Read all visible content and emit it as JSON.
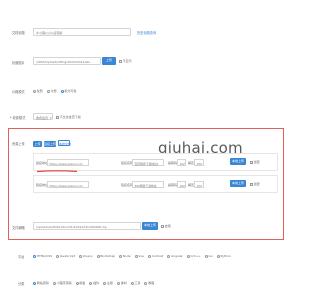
{
  "form": {
    "name_label": "文档标题",
    "name_value": "乡小镇(公众)运营版",
    "name_link": "历史标题查询",
    "cover_label": "封面图片",
    "cover_value": "/2063/Uploads/ifimg/2022/03/12/ab...",
    "cover_btn": "上传",
    "cover_check": "不显示",
    "cover_type_label": "价格模式",
    "cover_type_options": [
      "免费",
      "付费",
      "积分可免"
    ],
    "status_label": "* 收费模式",
    "status_select": "收费会员",
    "status_check": "不允许会员下载"
  },
  "upload": {
    "label": "资源上传",
    "tabs": [
      "上传",
      "链接上传",
      "本地文档"
    ],
    "rows": [
      {
        "url_label": "链接地址:",
        "url_value": "https://www.qiuhai.com",
        "name_label": "链接名称:",
        "name_value": "百度网盘下载地址1",
        "code_label": "提取码:",
        "code_value": "102",
        "pwd_label": "解压:",
        "pwd_value": "100",
        "btn": "本地上传",
        "check": "加密"
      },
      {
        "url_label": "链接地址:",
        "url_value": "https://www.qiuhai.com",
        "name_label": "链接名称:",
        "name_value": "360网盘下载地址",
        "code_label": "提取码:",
        "code_value": "102",
        "pwd_label": "解压:",
        "pwd_value": "100",
        "btn": "本地上传",
        "check": "加密"
      }
    ],
    "file_label": "文件缩略",
    "file_value": "/uploads/soft/2019/1231/20191231/000000.zip",
    "file_btn": "本地上传",
    "file_check": "启用"
  },
  "watermark": "qiuhai.com",
  "platform": {
    "label": "平台",
    "options": [
      "HTML/CSS",
      "JavaScript",
      "jQuery",
      "Bootstrap",
      "Node",
      "Vue",
      "Android",
      "Angular",
      "C/C++",
      "Go",
      "Python"
    ]
  },
  "category": {
    "label": "分类",
    "options": [
      "网站源码",
      "小程序源码",
      "模板",
      "插件",
      "主题",
      "素材",
      "工具",
      "教程"
    ]
  },
  "colors": {
    "accent": "#3a86d6",
    "highlight_border": "#e0605c",
    "underline": "#e23b3b"
  }
}
